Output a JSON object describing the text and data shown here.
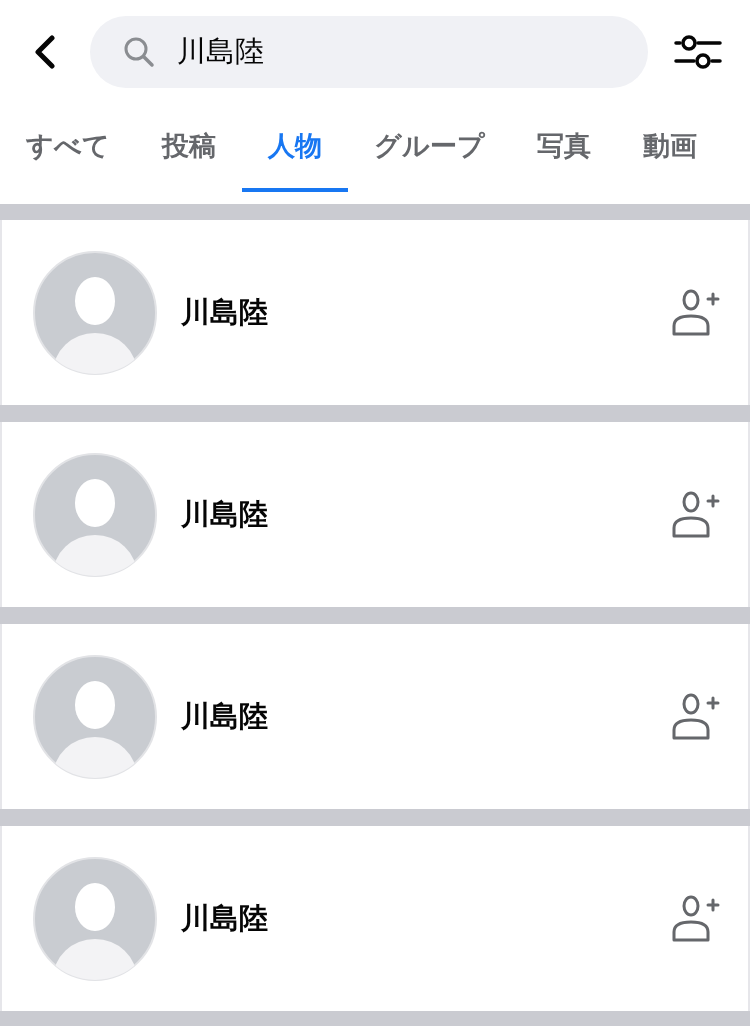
{
  "search": {
    "value": "川島陸"
  },
  "tabs": [
    {
      "label": "すべて",
      "selected": false
    },
    {
      "label": "投稿",
      "selected": false
    },
    {
      "label": "人物",
      "selected": true
    },
    {
      "label": "グループ",
      "selected": false
    },
    {
      "label": "写真",
      "selected": false
    },
    {
      "label": "動画",
      "selected": false
    }
  ],
  "people": [
    {
      "name": "川島陸"
    },
    {
      "name": "川島陸"
    },
    {
      "name": "川島陸"
    },
    {
      "name": "川島陸"
    }
  ]
}
